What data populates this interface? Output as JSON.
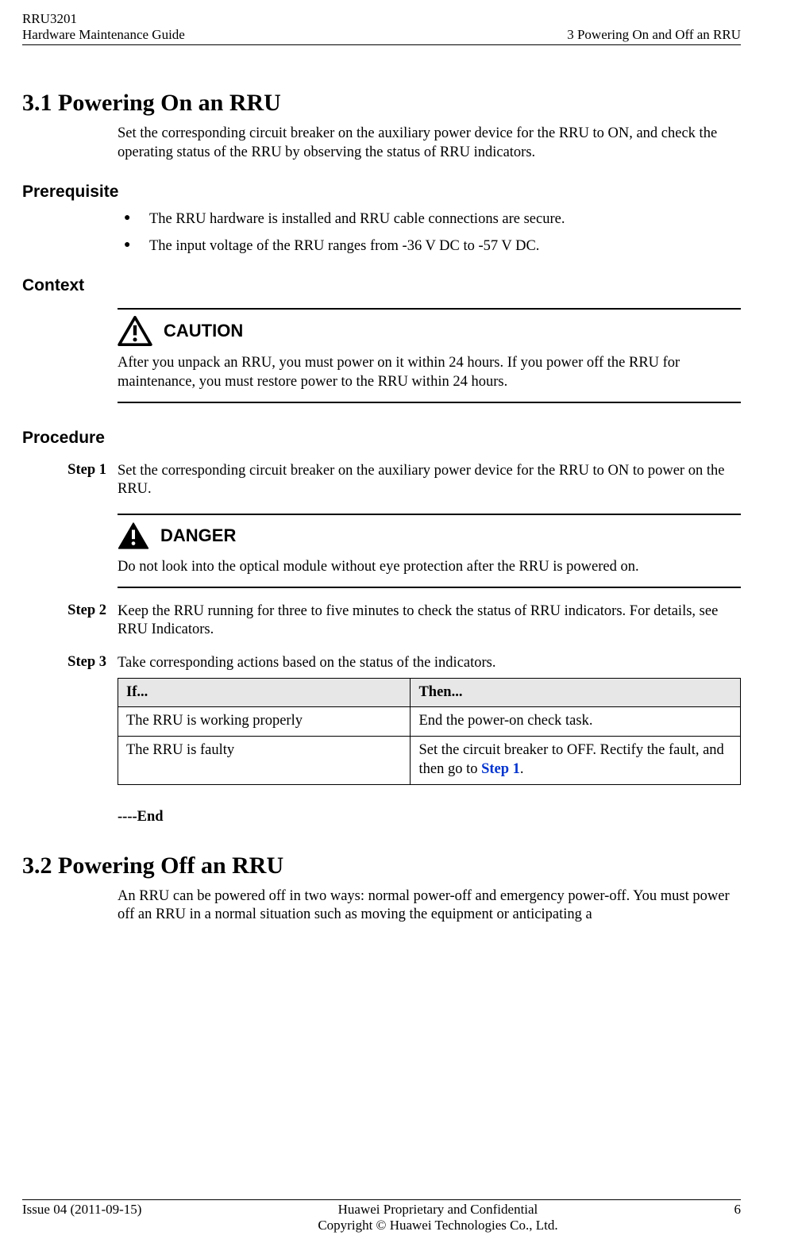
{
  "header": {
    "topLeft1": "RRU3201",
    "topLeft2": "Hardware Maintenance Guide",
    "topRight": "3 Powering On and Off an RRU"
  },
  "sec31": {
    "title": "3.1 Powering On an RRU",
    "intro": "Set the corresponding circuit breaker on the auxiliary power device for the RRU to ON, and check the operating status of the RRU by observing the status of RRU indicators."
  },
  "prereq": {
    "heading": "Prerequisite",
    "items": [
      "The RRU hardware is installed and RRU cable connections are secure.",
      "The input voltage of the RRU ranges from -36 V DC to -57 V DC."
    ]
  },
  "context": {
    "heading": "Context",
    "callout_label": "CAUTION",
    "callout_text": "After you unpack an RRU, you must power on it within 24 hours. If you power off the RRU for maintenance, you must restore power to the RRU within 24 hours."
  },
  "procedure": {
    "heading": "Procedure",
    "steps": {
      "s1_label": "Step 1",
      "s1_text": "Set the corresponding circuit breaker on the auxiliary power device for the RRU to ON to power on the RRU.",
      "danger_label": "DANGER",
      "danger_text": "Do not look into the optical module without eye protection after the RRU is powered on.",
      "s2_label": "Step 2",
      "s2_text": "Keep the RRU running for three to five minutes to check the status of RRU indicators. For details, see RRU Indicators.",
      "s3_label": "Step 3",
      "s3_text": "Take corresponding actions based on the status of the indicators."
    },
    "table": {
      "h1": "If...",
      "h2": "Then...",
      "r1c1": "The RRU is working properly",
      "r1c2": "End the power-on check task.",
      "r2c1": "The RRU is faulty",
      "r2c2a": "Set the circuit breaker to OFF. Rectify the fault, and then go to ",
      "r2c2link": "Step 1",
      "r2c2b": "."
    },
    "end": "----End"
  },
  "sec32": {
    "title": "3.2 Powering Off an RRU",
    "intro": "An RRU can be powered off in two ways: normal power-off and emergency power-off. You must power off an RRU in a normal situation such as moving the equipment or anticipating a"
  },
  "footer": {
    "left": "Issue 04 (2011-09-15)",
    "center1": "Huawei Proprietary and Confidential",
    "center2": "Copyright © Huawei Technologies Co., Ltd.",
    "right": "6"
  }
}
